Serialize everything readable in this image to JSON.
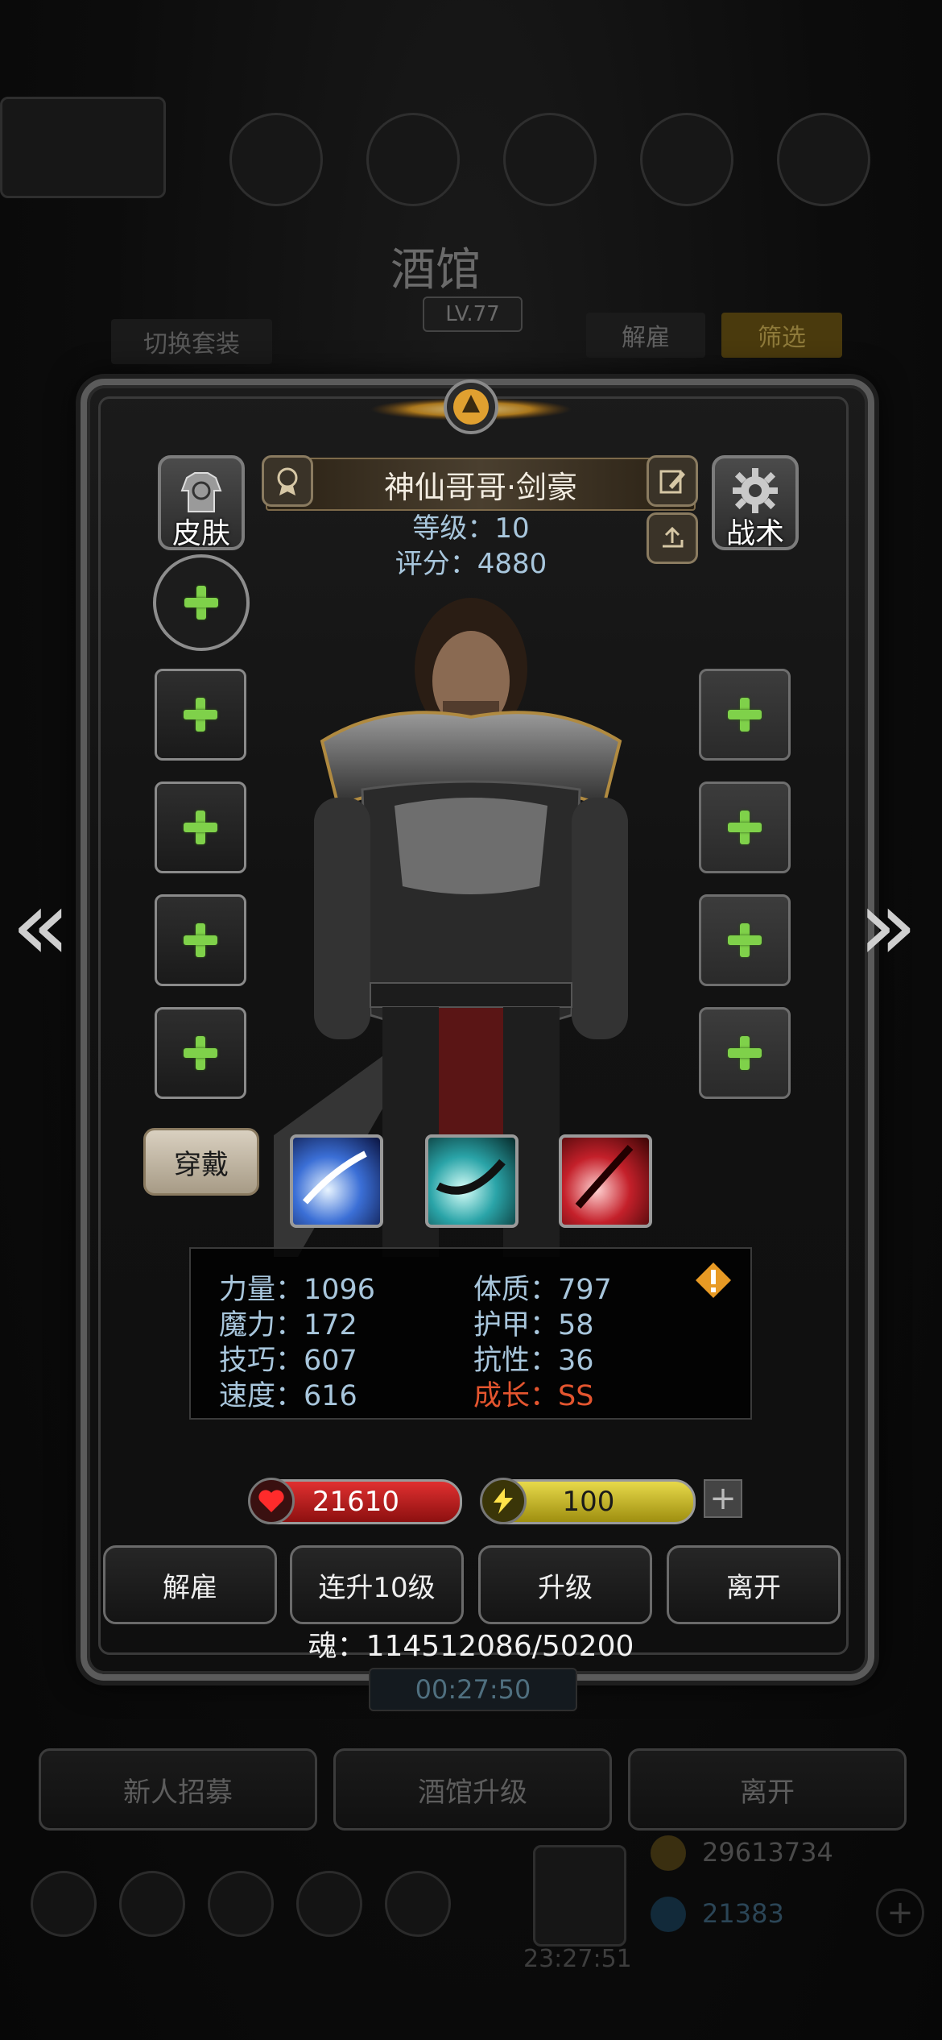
{
  "background": {
    "title": "酒馆",
    "level": "LV.77",
    "switch_outfit": "切换套装",
    "dismiss": "解雇",
    "filter": "筛选",
    "timer": "00:27:50",
    "buttons": {
      "recruit": "新人招募",
      "upgrade_tavern": "酒馆升级",
      "leave": "离开"
    },
    "clock": "23:27:51",
    "gold": "29613734",
    "gems": "21383"
  },
  "hero": {
    "name": "神仙哥哥·剑豪",
    "level_line": "等级：10",
    "score_line": "评分：4880",
    "skin_label": "皮肤",
    "tactics_label": "战术",
    "wear_label": "穿戴"
  },
  "stats": {
    "strength": "力量：1096",
    "magic": "魔力：172",
    "skill": "技巧：607",
    "speed": "速度：616",
    "constitution": "体质：797",
    "armor": "护甲：58",
    "resistance": "抗性：36",
    "growth": "成长：SS"
  },
  "bars": {
    "hp": "21610",
    "energy": "100",
    "hp_progress": 1.0,
    "energy_progress": 1.0
  },
  "actions": {
    "dismiss": "解雇",
    "level10": "连升10级",
    "upgrade": "升级",
    "leave": "离开"
  },
  "soul": "魂：114512086/50200",
  "colors": {
    "stat_text": "#a8c6dc",
    "growth": "#e4552f",
    "plus": "#7fd14a"
  },
  "icons": [
    "skin-icon",
    "gear-icon",
    "medal-icon",
    "edit-icon",
    "share-icon",
    "warning-icon",
    "heart-icon",
    "lightning-icon",
    "arrow-left-icon",
    "arrow-right-icon"
  ]
}
